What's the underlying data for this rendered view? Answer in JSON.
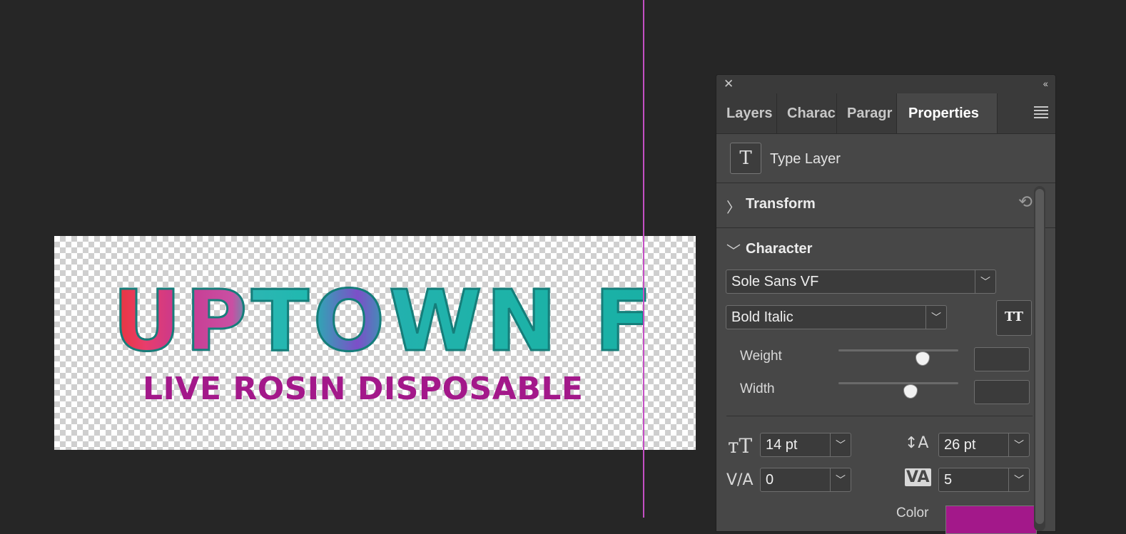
{
  "canvas": {
    "headline": "UPTOWN F",
    "subline": "LIVE ROSIN DISPOSABLE"
  },
  "panel": {
    "tabs": [
      "Layers",
      "Charac",
      "Paragr",
      "Properties"
    ],
    "active_tab": "Properties",
    "layer_kind_icon": "T",
    "layer_kind": "Type Layer",
    "transform": {
      "title": "Transform"
    },
    "character": {
      "title": "Character",
      "font_family": "Sole Sans VF",
      "font_style": "Bold Italic",
      "weight_label": "Weight",
      "width_label": "Width",
      "weight_value": 0.7,
      "width_value": 0.6,
      "font_size": "14 pt",
      "leading": "26 pt",
      "kerning": "0",
      "tracking": "5",
      "color_label": "Color",
      "color": "#a3188a"
    }
  },
  "colors": {
    "background": "#262626",
    "panel": "#474747",
    "guide": "#c44fc4",
    "accent_text": "#a3188a"
  }
}
